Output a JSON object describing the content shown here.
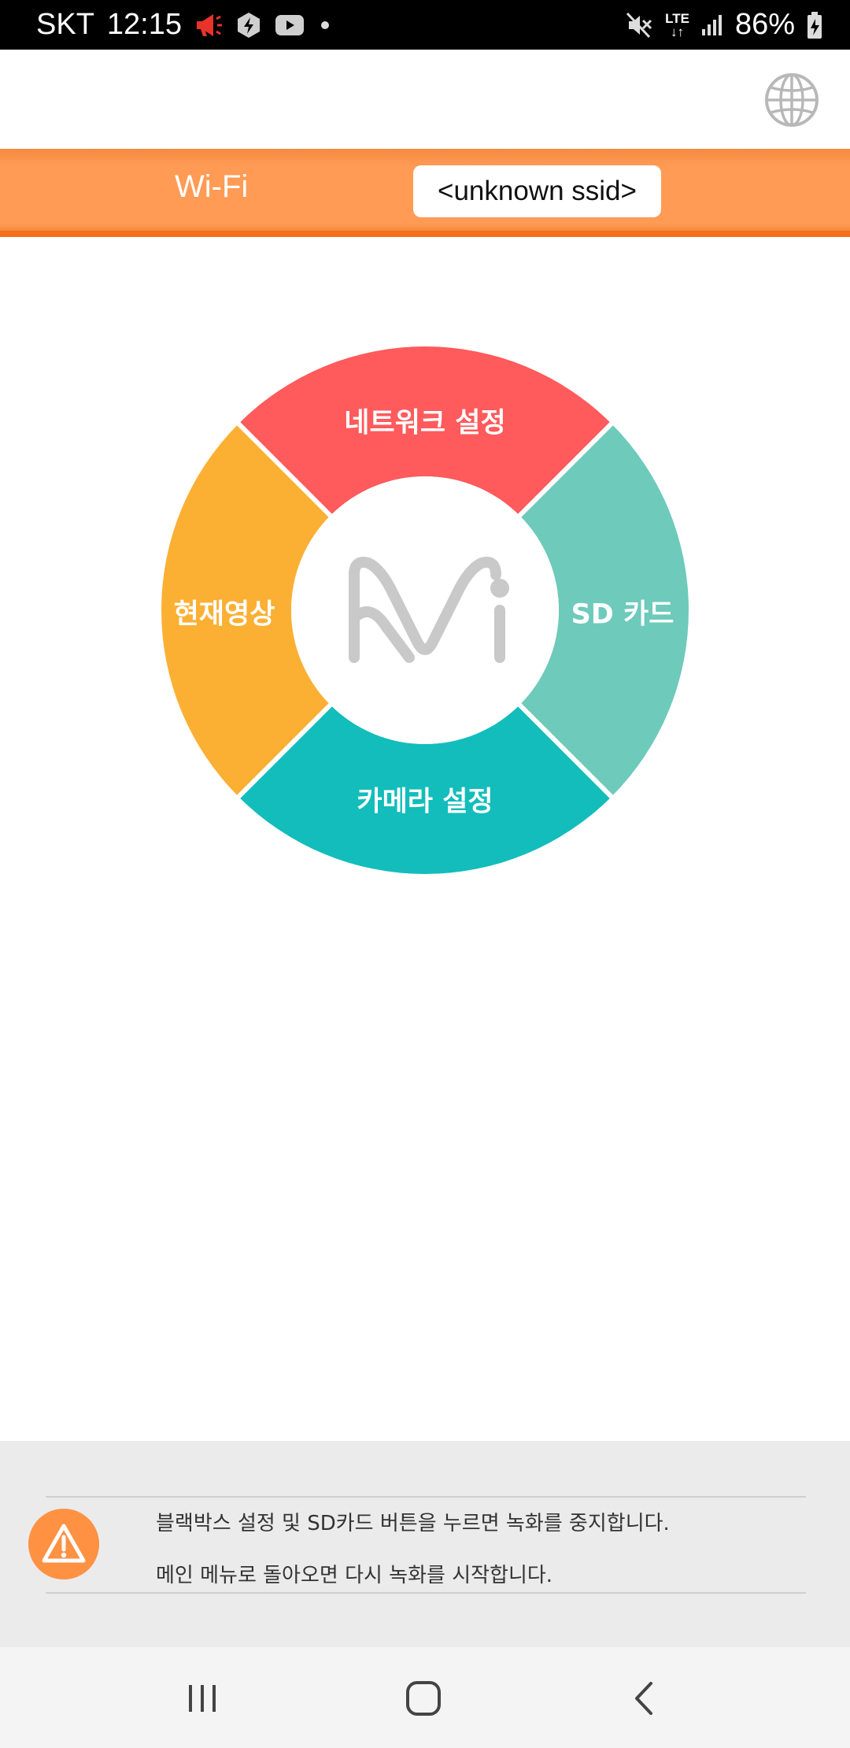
{
  "status_bar": {
    "carrier": "SKT",
    "time": "12:15",
    "network": "LTE",
    "battery": "86%"
  },
  "header": {
    "language_icon": "globe-icon"
  },
  "wifi": {
    "label": "Wi-Fi",
    "ssid": "<unknown ssid>"
  },
  "menu": {
    "network_settings": "네트워크 설정",
    "sd_card": "SD 카드",
    "camera_settings": "카메라 설정",
    "live_view": "현재영상",
    "colors": {
      "network": "#ff5a5c",
      "sd": "#6ecabb",
      "camera": "#12bdbb",
      "live": "#fbb034"
    },
    "logo": "mi-logo"
  },
  "notice": {
    "icon": "warning-icon",
    "line1": "블랙박스 설정 및 SD카드 버튼을 누르면 녹화를 중지합니다.",
    "line2": "메인 메뉴로 돌아오면 다시 녹화를 시작합니다."
  },
  "nav": {
    "recents": "recents-icon",
    "home": "home-icon",
    "back": "back-icon"
  }
}
